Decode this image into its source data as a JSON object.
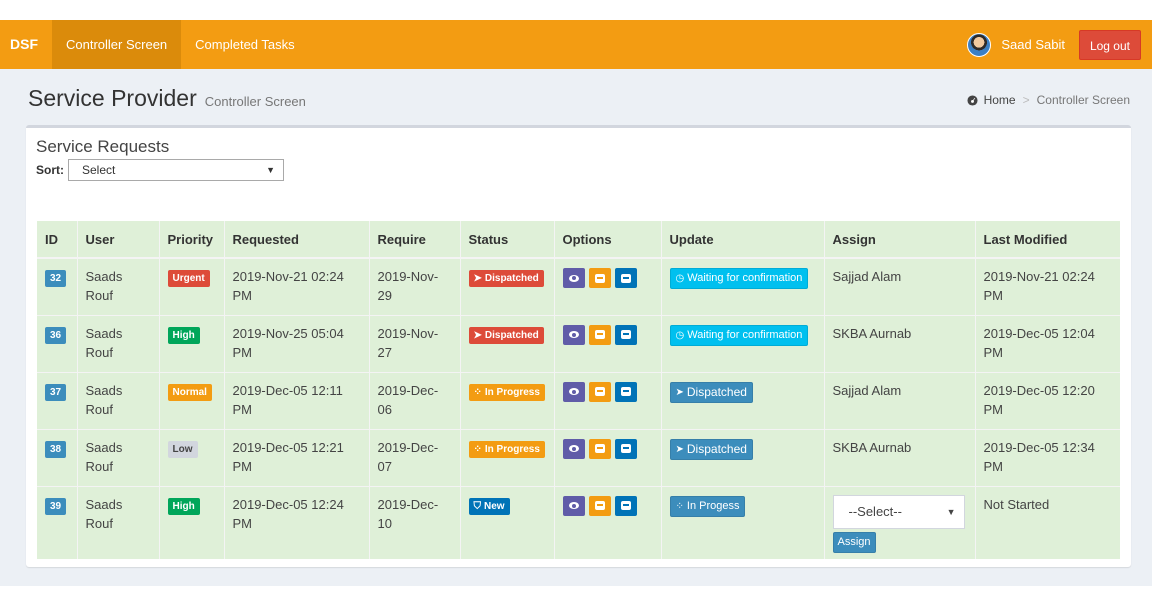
{
  "nav": {
    "brand": "DSF",
    "links": [
      "Controller Screen",
      "Completed Tasks"
    ],
    "user": "Saad Sabit",
    "logout": "Log out"
  },
  "page": {
    "title": "Service Provider",
    "subtitle": "Controller Screen",
    "breadcrumb": [
      "Home",
      "Controller Screen"
    ]
  },
  "box": {
    "title": "Service Requests",
    "sort_label": "Sort:",
    "sort_value": "Select"
  },
  "table": {
    "headers": [
      "ID",
      "User",
      "Priority",
      "Requested",
      "Require",
      "Status",
      "Options",
      "Update",
      "Assign",
      "Last Modified"
    ],
    "rows": [
      {
        "id": "32",
        "user_line1": "Saads",
        "user_line2": "Rouf",
        "priority": "Urgent",
        "requested": "2019-Nov-21 02:24 PM",
        "require": "2019-Nov-29",
        "status": "Dispatched",
        "update": "Waiting for confirmation",
        "assign": "Sajjad Alam",
        "modified": "2019-Nov-21 02:24 PM"
      },
      {
        "id": "36",
        "user_line1": "Saads",
        "user_line2": "Rouf",
        "priority": "High",
        "requested": "2019-Nov-25 05:04 PM",
        "require": "2019-Nov-27",
        "status": "Dispatched",
        "update": "Waiting for confirmation",
        "assign": "SKBA Aurnab",
        "modified": "2019-Dec-05 12:04 PM"
      },
      {
        "id": "37",
        "user_line1": "Saads",
        "user_line2": "Rouf",
        "priority": "Normal",
        "requested": "2019-Dec-05 12:11 PM",
        "require": "2019-Dec-06",
        "status": "In Progress",
        "update": "Dispatched",
        "assign": "Sajjad Alam",
        "modified": "2019-Dec-05 12:20 PM"
      },
      {
        "id": "38",
        "user_line1": "Saads",
        "user_line2": "Rouf",
        "priority": "Low",
        "requested": "2019-Dec-05 12:21 PM",
        "require": "2019-Dec-07",
        "status": "In Progress",
        "update": "Dispatched",
        "assign": "SKBA Aurnab",
        "modified": "2019-Dec-05 12:34 PM"
      },
      {
        "id": "39",
        "user_line1": "Saads",
        "user_line2": "Rouf",
        "priority": "High",
        "requested": "2019-Dec-05 12:24 PM",
        "require": "2019-Dec-10",
        "status": "New",
        "update": "In Progess",
        "assign_select": "--Select--",
        "assign_button": "Assign",
        "modified": "Not Started"
      }
    ]
  },
  "colors": {
    "navbar": "#f39c12",
    "urgent": "#dd4b39",
    "high": "#00a65a",
    "normal": "#f39c12",
    "low": "#d2d6de",
    "primary": "#3c8dbc",
    "info": "#00c0ef",
    "row_bg": "#dff0d8"
  }
}
